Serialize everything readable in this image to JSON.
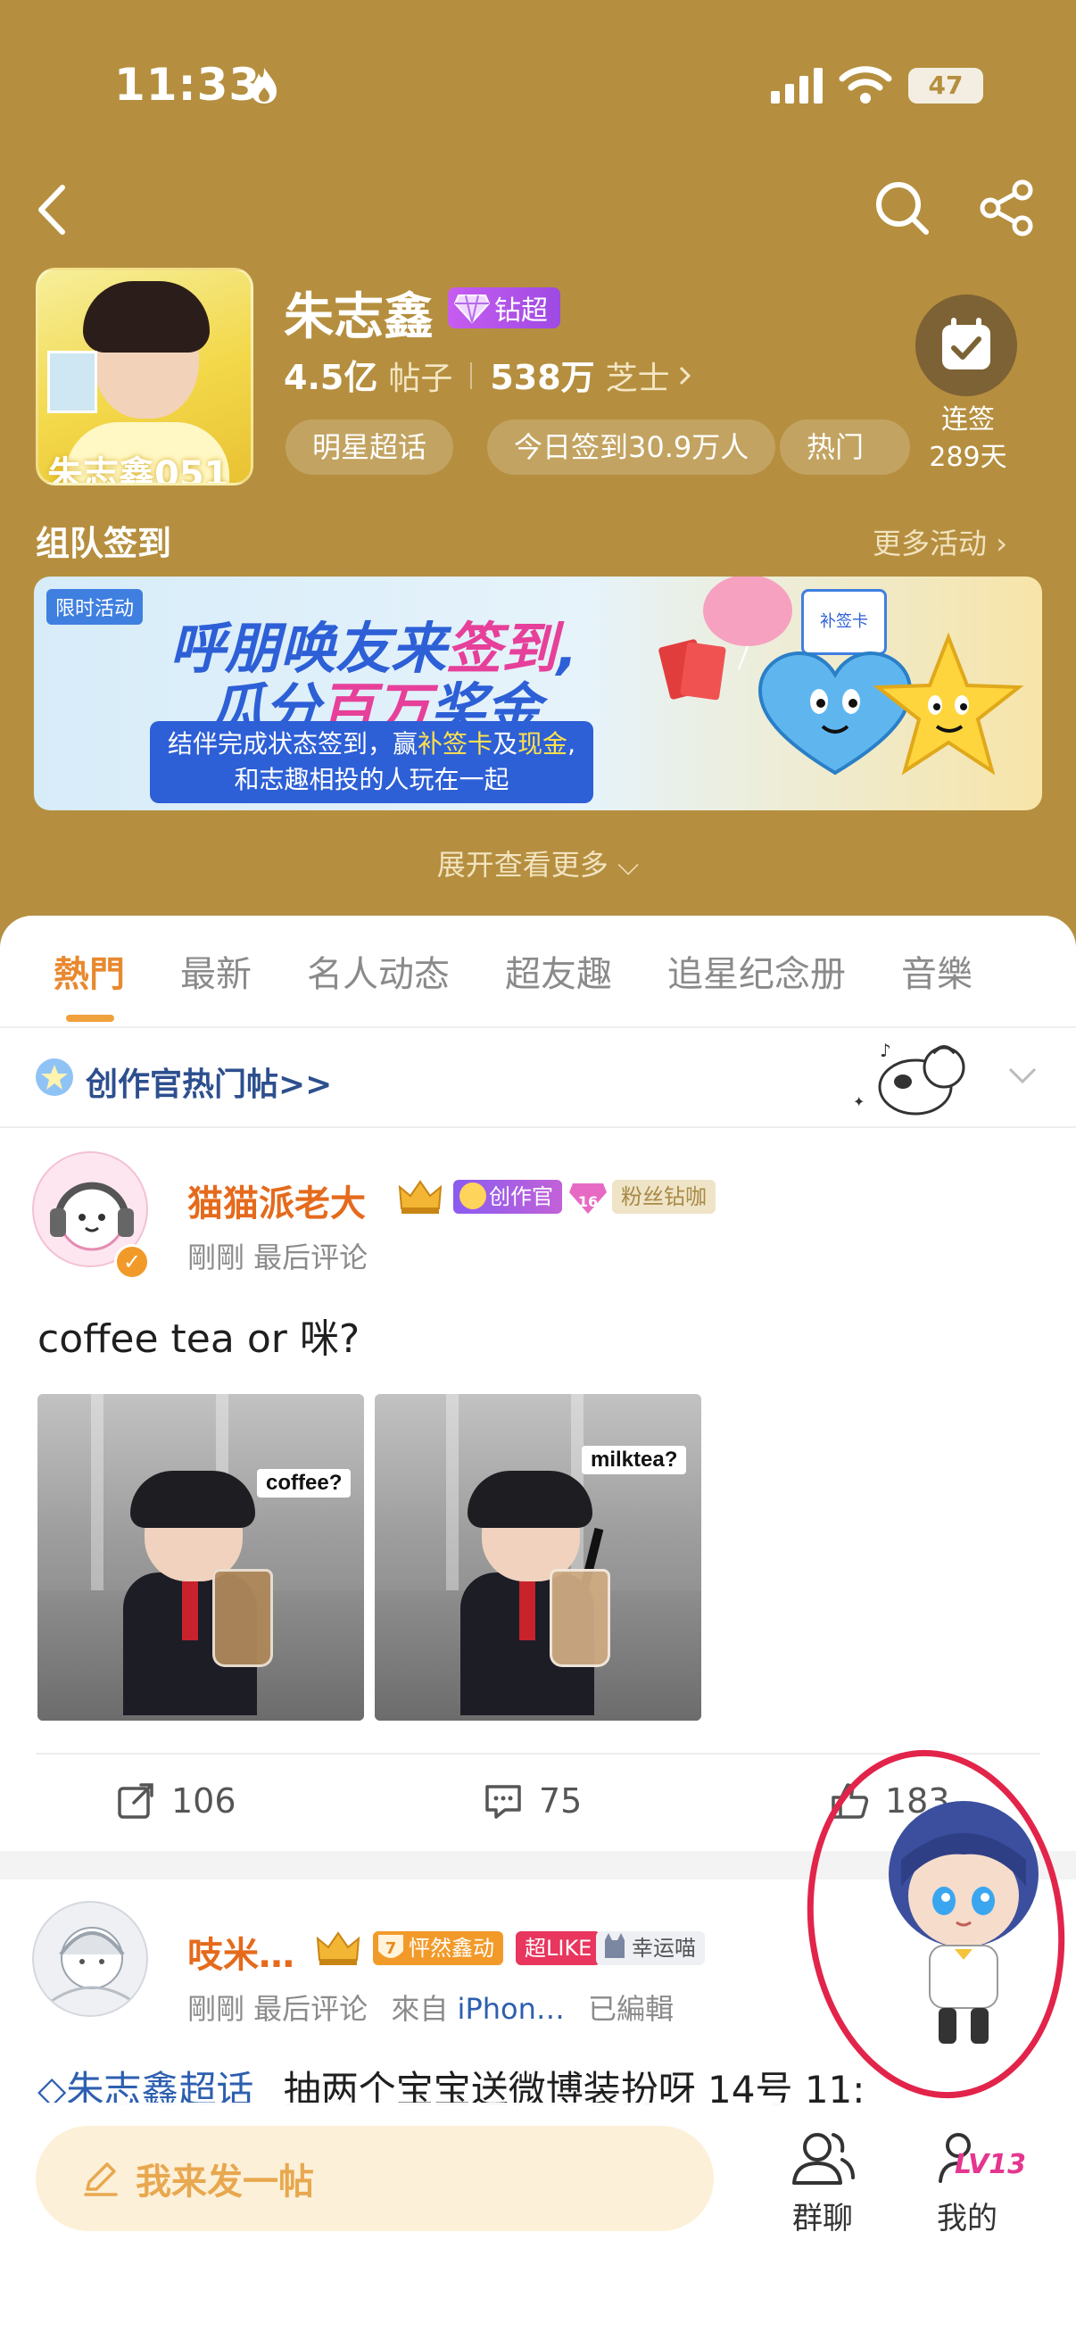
{
  "status_bar": {
    "time": "11:33",
    "battery": "47"
  },
  "star": {
    "name": "朱志鑫",
    "level_badge": "钻超",
    "posts_count": "4.5亿",
    "posts_unit": "帖子",
    "fans_count": "538万",
    "fans_unit": "芝士",
    "chips": [
      "明星超话",
      "今日签到30.9万人",
      "热门"
    ],
    "checkin_label": "连签",
    "checkin_days": "289天",
    "avatar_caption": "朱志鑫051"
  },
  "team": {
    "title": "组队签到",
    "more": "更多活动"
  },
  "banner": {
    "tag": "限时活动",
    "headline_1a": "呼朋唤友来",
    "headline_1b": "签到",
    "headline_2a": "瓜分",
    "headline_2b": "百万",
    "headline_2c": "奖金",
    "sub_line_1a": "结伴完成状态签到，赢",
    "sub_line_1b": "补签卡",
    "sub_line_1c": "及",
    "sub_line_1d": "现金",
    "sub_line_2": "和志趣相投的人玩在一起",
    "card_text": "补签卡"
  },
  "expand_label": "展开查看更多",
  "tabs": [
    "熱門",
    "最新",
    "名人动态",
    "超友趣",
    "追星纪念册",
    "音樂"
  ],
  "creator_section": {
    "label": "创作官热门帖>>"
  },
  "post1": {
    "author": "猫猫派老大",
    "badges": [
      "创作官",
      "粉丝钻咖"
    ],
    "level_num": "16",
    "meta": "剛剛 最后评论",
    "text": "coffee tea or 咪?",
    "photos": [
      {
        "caption": "coffee?"
      },
      {
        "caption": "milktea?"
      }
    ],
    "shares": "106",
    "comments": "75",
    "likes": "183"
  },
  "post2": {
    "author": "吱米…",
    "badges": [
      "怦然鑫动",
      "超LIKE",
      "幸运喵"
    ],
    "level_num": "7",
    "meta_time": "剛剛 最后评论",
    "meta_from": "來自",
    "meta_device": "iPhon…",
    "meta_edited": "已編輯",
    "topic": "朱志鑫超话",
    "text": "抽两个宝宝送微博装扮呀 14号 11:"
  },
  "bottom_nav": {
    "compose": "我来发一帖",
    "group_chat": "群聊",
    "mine": "我的",
    "level": "LV13"
  },
  "colors": {
    "header_gold": "#b58f3f",
    "accent_orange": "#e8892f",
    "link_blue": "#2d5fb0",
    "annotation_red": "#e2244a"
  }
}
